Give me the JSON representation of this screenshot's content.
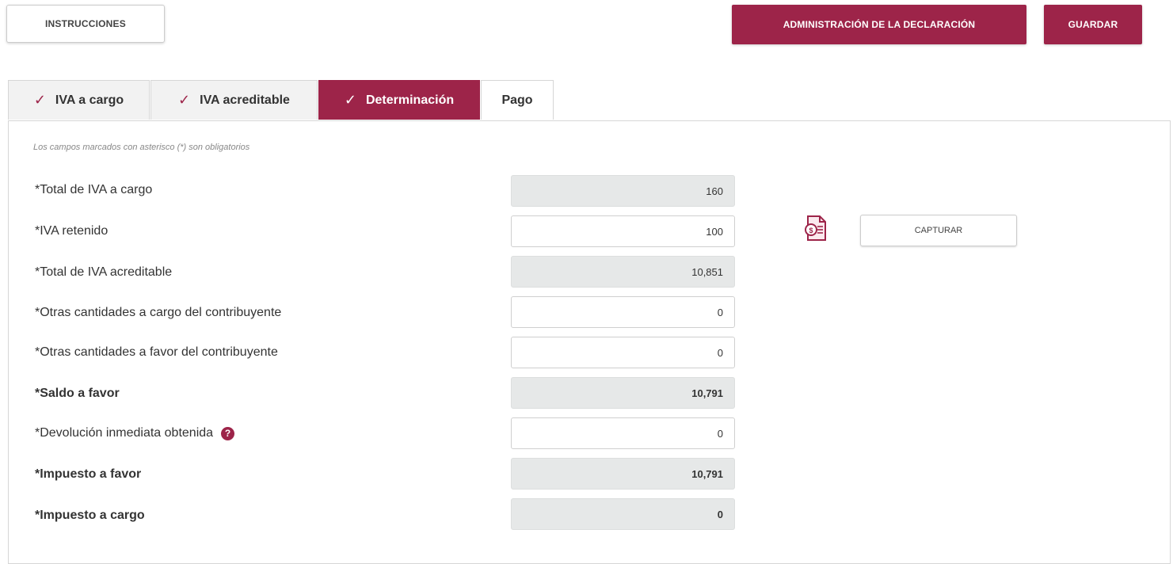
{
  "header": {
    "instructions_label": "INSTRUCCIONES",
    "admin_label": "ADMINISTRACIÓN DE LA DECLARACIÓN",
    "save_label": "GUARDAR"
  },
  "tabs": [
    {
      "label": "IVA a cargo",
      "checked": true,
      "active": false
    },
    {
      "label": "IVA acreditable",
      "checked": true,
      "active": false
    },
    {
      "label": "Determinación",
      "checked": true,
      "active": true
    },
    {
      "label": "Pago",
      "checked": false,
      "active": false
    }
  ],
  "form": {
    "note": "Los campos marcados con asterisco (*) son obligatorios",
    "rows": [
      {
        "label": "*Total de IVA a cargo",
        "value": "160",
        "readonly": true,
        "bold": false
      },
      {
        "label": "*IVA retenido",
        "value": "100",
        "readonly": false,
        "bold": false
      },
      {
        "label": "*Total de IVA acreditable",
        "value": "10,851",
        "readonly": true,
        "bold": false
      },
      {
        "label": "*Otras cantidades a cargo del contribuyente",
        "value": "0",
        "readonly": false,
        "bold": false
      },
      {
        "label": "*Otras cantidades a favor del contribuyente",
        "value": "0",
        "readonly": false,
        "bold": false
      },
      {
        "label": "*Saldo a favor",
        "value": "10,791",
        "readonly": true,
        "bold": true
      },
      {
        "label": "*Devolución inmediata obtenida",
        "value": "0",
        "readonly": false,
        "bold": false
      },
      {
        "label": "*Impuesto a favor",
        "value": "10,791",
        "readonly": true,
        "bold": true
      },
      {
        "label": "*Impuesto a cargo",
        "value": "0",
        "readonly": true,
        "bold": true
      }
    ],
    "help_glyph": "?",
    "capture_label": "CAPTURAR"
  },
  "colors": {
    "accent": "#9d2449",
    "readonly_bg": "#e6e8e8"
  },
  "icons": {
    "tab_check": "✓",
    "document": "document-search-icon",
    "help": "question-circle-icon"
  }
}
